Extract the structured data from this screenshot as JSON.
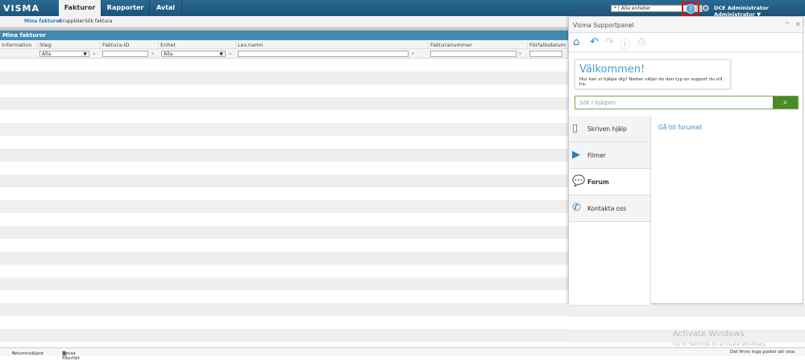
{
  "app": {
    "logo": "VISMA",
    "tabs": [
      "Fakturor",
      "Rapporter",
      "Avtal"
    ],
    "unit_select": "* | Alla enheter",
    "user": "DCE Administrator Administrator ▼",
    "help_icon": "?"
  },
  "subnav": [
    "Mina fakturor",
    "Gruppköer",
    "Sök faktura"
  ],
  "grid": {
    "title": "Mina fakturor",
    "columns": [
      "Information",
      "Steg",
      "Faktura-ID",
      "Enhet",
      "Lev.namn",
      "Fakturanummer",
      "Förfallodatum"
    ],
    "filters": {
      "steg": "Alla",
      "enhet": "Alla"
    },
    "clear": "x"
  },
  "footer": {
    "column_picker": "Kolumnväljare",
    "clear_filters": "Rensa filterfält",
    "status": "Det finns inga poster att visa"
  },
  "watermark": {
    "title": "Activate Windows",
    "sub": "Go to Settings to activate Windows."
  },
  "panel": {
    "title": "Visma Supportpanel",
    "welcome_title": "Välkommen!",
    "welcome_text": "Hur kan vi hjälpa dig? Nedan väljer du den typ av support du vill ha.",
    "search_placeholder": "Sök i hjälpen",
    "menu": [
      "Skriven hjälp",
      "Filmer",
      "Forum",
      "Kontakta oss"
    ],
    "active": "Forum",
    "link": "Gå till forumet"
  },
  "colors": {
    "topbar": "#1d5478",
    "header": "#3f89b3",
    "accent": "#4a9ad0",
    "search_button": "#4a8a28",
    "highlight": "#e01010"
  }
}
